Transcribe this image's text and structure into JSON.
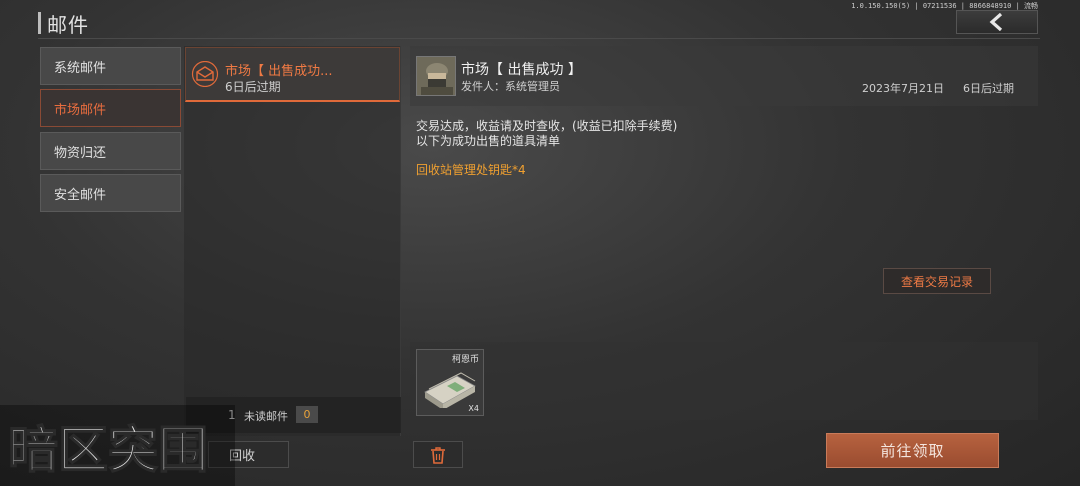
{
  "header": {
    "title": "邮件",
    "version": "1.0.150.150(5) | 07211536 | 8866848910 | 流畅"
  },
  "categories": [
    {
      "label": "系统邮件",
      "active": false
    },
    {
      "label": "市场邮件",
      "active": true
    },
    {
      "label": "物资归还",
      "active": false
    },
    {
      "label": "安全邮件",
      "active": false
    }
  ],
  "mail_list": {
    "items": [
      {
        "subject": "市场【 出售成功...",
        "expiry": "6日后过期",
        "selected": true
      }
    ],
    "unread_label": "未读邮件",
    "unread_count": "0",
    "list_count": "1",
    "recycle_label": "回收"
  },
  "detail": {
    "title": "市场【 出售成功 】",
    "sender": "发件人：系统管理员",
    "date": "2023年7月21日",
    "expiry": "6日后过期",
    "body_line1": "交易达成，收益请及时查收，(收益已扣除手续费)",
    "body_line2": "以下为成功出售的道具清单",
    "item_line": "回收站管理处钥匙*4",
    "view_records_label": "查看交易记录",
    "attachments": [
      {
        "name": "柯恩币",
        "qty": "X4"
      }
    ],
    "claim_label": "前往领取"
  },
  "watermark": {
    "text": "暗区突围"
  },
  "colors": {
    "accent": "#e86d3f",
    "gold": "#f0a030",
    "claim_button": "#a8553a"
  }
}
